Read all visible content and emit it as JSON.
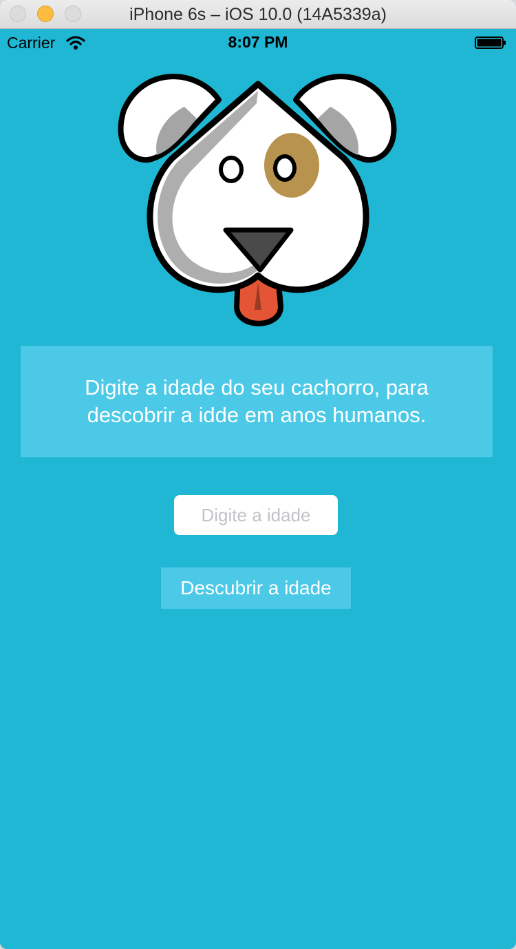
{
  "window": {
    "title": "iPhone 6s – iOS 10.0 (14A5339a)"
  },
  "status_bar": {
    "carrier": "Carrier",
    "time": "8:07 PM"
  },
  "icons": {
    "wifi": "wifi-icon",
    "battery": "battery-icon",
    "dog": "dog-face-icon"
  },
  "main": {
    "instructions": "Digite a idade do seu cachorro, para descobrir a idde em anos humanos.",
    "age_input": {
      "placeholder": "Digite a idade",
      "value": ""
    },
    "discover_button_label": "Descubrir a idade"
  },
  "colors": {
    "background": "#1fb7d4",
    "box_accent": "#4cc9e6",
    "window_minimize": "#fdbc40"
  }
}
